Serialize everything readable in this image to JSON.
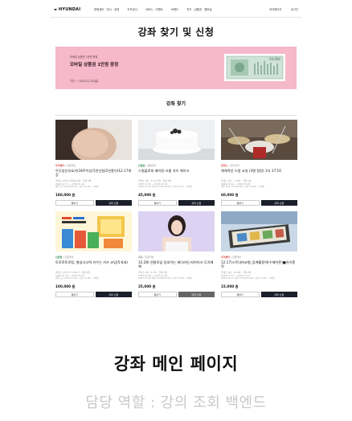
{
  "header": {
    "logo": "HYUNDAI",
    "menu": [
      "문화센터 · 전시 · 공연",
      "키즈강사",
      "서비스 · 이벤트",
      "브랜드",
      "카드 · 상품권 · 멤버십"
    ],
    "right": [
      "마이페이지",
      "로그인"
    ]
  },
  "page_title": "강좌 찾기 및 신청",
  "banner": {
    "subtitle": "모바일 상품권 1만원 증정",
    "title": "모바일 상품권 1만원 증정",
    "period": "기간 : ~2023.12.31(일)",
    "voucher_amount": "10,000"
  },
  "section_title": "강좌 찾기",
  "cards": [
    {
      "store": "무역센터",
      "category": "인문학습",
      "title": "우무임신부요가(16주이상/1인신청/2인용이)12.17개강",
      "meta": [
        "클래스 12월 2·윤미숙 6회 · 현재 3명",
        "2023.12.17 ~ 2024.01.14",
        "매주 일 10:00-10:50 / 시간 11:00 ~ 20분"
      ],
      "price": "180,000 원",
      "wish": "찜하기",
      "apply": "강좌 신청",
      "tag_color": "#d23c3c",
      "disabled": false
    },
    {
      "store": "신촌점",
      "category": "생활요리",
      "title": "스윗플로피 베이킹-크롬 치즈 케이크",
      "meta": [
        "클래스 1회 · 6·3단 2월 · 현재 1명",
        "2023.12.10 ~ 2023.12.10",
        "2023.12.10 (일) 13:00-14:50 / 시간 12:10 ~ 20분"
      ],
      "price": "45,000 원",
      "wish": "찜하기",
      "apply": "강좌 신청",
      "tag_color": "#2a8a4a",
      "disabled": false
    },
    {
      "store": "킨텍스",
      "category": "취미·여가",
      "title": "체계적인 드럼 교실 (3명 정원) 1차 17:10",
      "meta": [
        "클래스 1회 · 7·26회 · 현재 1명",
        "2024.01.04 ~ 2024.03.28",
        "매주 목 17:10-18:00 / 시간 11:00 ~ 20분"
      ],
      "price": "60,000 원",
      "wish": "찜하기",
      "apply": "강좌 신청",
      "tag_color": "#d23c3c",
      "disabled": false
    },
    {
      "store": "신촌점",
      "category": "인문학습",
      "title": "토로로토로킹, 형성사고력 키우는 키즈 코딩(5-6세)",
      "meta": [
        "클래스 12월 3·7·5/21기 · 현재 3명",
        "2024.01.13 ~ 2024.02.25",
        "매주 토 11:00-11:50 / 시간 11:00 ~ 20분"
      ],
      "price": "100,000 원",
      "wish": "찜하기",
      "apply": "강좌 신청",
      "tag_color": "#2a8a4a",
      "disabled": false
    },
    {
      "store": "목동",
      "category": "인문학습",
      "title": "12.28) 연말모임 동호어는 헤디라인.자아미크 무치해해",
      "meta": [
        "클래스 1회 · 4·3회 · 현재 1명",
        "2023.12.28 ~ 2023.12.28",
        "2023.12.28 (목) 19:00-20:00 / 시간 11:00 ~ 20분"
      ],
      "price": "25,000 원",
      "wish": "찜하기",
      "apply": "강좌 신청",
      "tag_color": "#888888",
      "disabled": true
    },
    {
      "store": "무역센터",
      "category": "인문학습",
      "title": "12.17)스트다마코형_동계활동박(수채어른)■아이흥작",
      "meta": [
        "클래스 1회 · 18·6회 · 현재 2명",
        "2023.12.17 ~ 2023.12.17",
        "2023.12.17 (일) 13:30-15:00 / 시간 11:00 ~ 20분"
      ],
      "price": "15,000 원",
      "wish": "찜하기",
      "apply": "강좌 신청",
      "tag_color": "#d23c3c",
      "disabled": false
    }
  ],
  "caption": {
    "main": "강좌 메인 페이지",
    "sub": "담당 역할 : 강의 조회 백엔드"
  },
  "colors": {
    "banner_bg": "#f6b8cb",
    "dark_button": "#1a1f2a"
  }
}
